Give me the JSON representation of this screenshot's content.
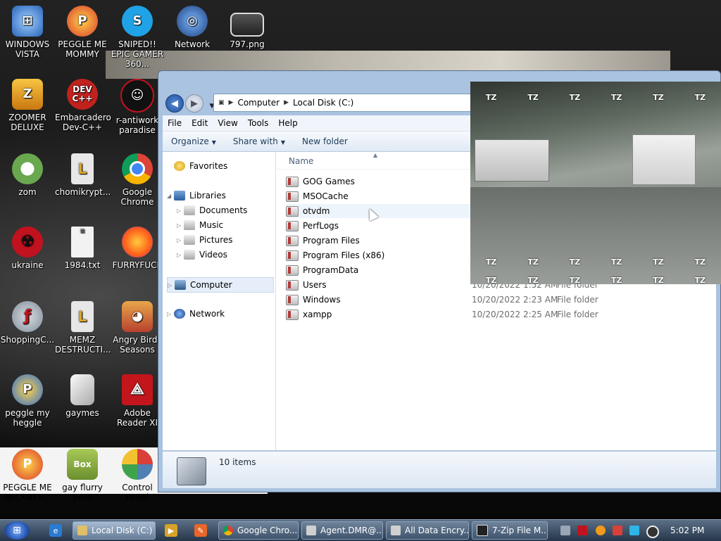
{
  "desktop": {
    "icons": [
      {
        "label": "WINDOWS VISTA",
        "icon": "windows-vista-icon",
        "color": "#3a7bd5"
      },
      {
        "label": "PEGGLE ME MOMMY",
        "icon": "peggle-icon",
        "color": "#d93b2b"
      },
      {
        "label": "SNIPED!! EPIC GAMER 360...",
        "icon": "skype-icon",
        "color": "#1fa3e6"
      },
      {
        "label": "Network",
        "icon": "network-icon",
        "color": "#2d4f8a"
      },
      {
        "label": "797.png",
        "icon": "image-file-icon",
        "color": "#444"
      },
      {
        "label": "ZOOMER DELUXE",
        "icon": "zoomer-icon",
        "color": "#e8a21a"
      },
      {
        "label": "Embarcadero Dev-C++",
        "icon": "devcpp-icon",
        "color": "#c0221e"
      },
      {
        "label": "r-antiwork paradise",
        "icon": "reddit-icon",
        "color": "#222"
      },
      {
        "label": "zom",
        "icon": "flower-icon",
        "color": "#6aa84f"
      },
      {
        "label": "chomikrypt...",
        "icon": "lock-file-icon",
        "color": "#d9a728"
      },
      {
        "label": "Google Chrome",
        "icon": "chrome-icon",
        "color": "#2e9d4a"
      },
      {
        "label": "ukraine",
        "icon": "radiation-icon",
        "color": "#c1121f"
      },
      {
        "label": "1984.txt",
        "icon": "text-file-icon",
        "color": "#e6e6e6"
      },
      {
        "label": "FURRYFUCK",
        "icon": "firefox-icon",
        "color": "#ff7a1a"
      },
      {
        "label": "ShoppingC...",
        "icon": "flash-icon",
        "color": "#7f8c99"
      },
      {
        "label": "MEMZ DESTRUCTI...",
        "icon": "lock-file-icon",
        "color": "#d9a728"
      },
      {
        "label": "Angry Birds Seasons",
        "icon": "angry-birds-icon",
        "color": "#b7412e"
      },
      {
        "label": "peggle my heggle",
        "icon": "peggle-icon",
        "color": "#2f6fd1"
      },
      {
        "label": "gaymes",
        "icon": "folder-icon",
        "color": "#c9c9c9"
      },
      {
        "label": "Adobe Reader XI",
        "icon": "adobe-reader-icon",
        "color": "#c3161c"
      },
      {
        "label": "PEGGLE ME NECKBEA...",
        "icon": "peggle-icon",
        "color": "#d93b2b"
      },
      {
        "label": "gay flurry porn",
        "icon": "box-icon",
        "color": "#6b8f2e"
      },
      {
        "label": "Control Panel",
        "icon": "control-panel-icon",
        "color": "#4f7fb3"
      }
    ],
    "box_text": "Box",
    "devcpp_text": "DEV C++"
  },
  "explorer": {
    "address": [
      "Computer",
      "Local Disk (C:)"
    ],
    "menu": [
      "File",
      "Edit",
      "View",
      "Tools",
      "Help"
    ],
    "toolbar": {
      "organize": "Organize",
      "share_with": "Share with",
      "new_folder": "New folder"
    },
    "nav": {
      "favorites": "Favorites",
      "libraries": "Libraries",
      "documents": "Documents",
      "music": "Music",
      "pictures": "Pictures",
      "videos": "Videos",
      "computer": "Computer",
      "network": "Network"
    },
    "columns": {
      "name": "Name"
    },
    "files": [
      {
        "name": "GOG Games",
        "date": "",
        "type": ""
      },
      {
        "name": "MSOCache",
        "date": "",
        "type": ""
      },
      {
        "name": "otvdm",
        "date": "",
        "type": ""
      },
      {
        "name": "PerfLogs",
        "date": "",
        "type": ""
      },
      {
        "name": "Program Files",
        "date": "",
        "type": ""
      },
      {
        "name": "Program Files (x86)",
        "date": "",
        "type": ""
      },
      {
        "name": "ProgramData",
        "date": "",
        "type": ""
      },
      {
        "name": "Users",
        "date": "10/20/2022 1:52 AM",
        "type": "File folder"
      },
      {
        "name": "Windows",
        "date": "10/20/2022 2:23 AM",
        "type": "File folder"
      },
      {
        "name": "xampp",
        "date": "10/20/2022 2:25 AM",
        "type": "File folder"
      }
    ],
    "status": {
      "items": "10 items"
    }
  },
  "video_overlay": {
    "watermark": "TZ"
  },
  "taskbar": {
    "buttons": [
      {
        "label": "Local Disk (C:)",
        "icon": "folder-icon",
        "color": "#e0c067"
      },
      {
        "label": "Google Chro...",
        "icon": "chrome-icon",
        "color": "#2e9d4a"
      },
      {
        "label": "Agent.DMR@...",
        "icon": "window-icon",
        "color": "#cfcfcf"
      },
      {
        "label": "All Data Encry...",
        "icon": "window-icon",
        "color": "#cfcfcf"
      },
      {
        "label": "7-Zip File M...",
        "icon": "sevenzip-icon",
        "color": "#222"
      }
    ],
    "clock": "5:02 PM"
  }
}
